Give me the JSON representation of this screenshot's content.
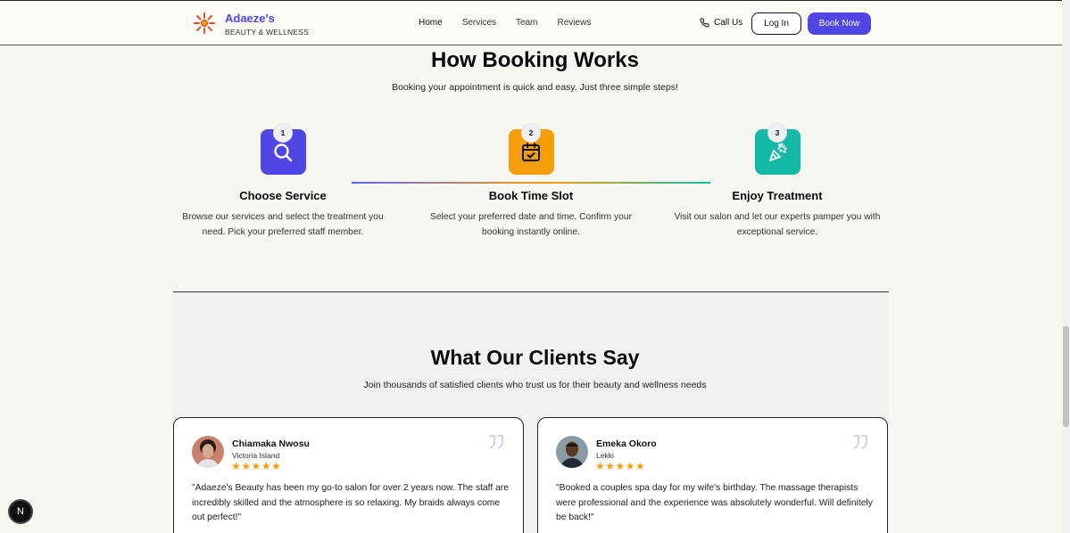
{
  "header": {
    "brand_name": "Adaeze's",
    "brand_tagline": "BEAUTY & WELLNESS",
    "nav": [
      {
        "label": "Home"
      },
      {
        "label": "Services"
      },
      {
        "label": "Team"
      },
      {
        "label": "Reviews"
      }
    ],
    "call_label": "Call Us",
    "login_label": "Log In",
    "book_label": "Book Now"
  },
  "booking": {
    "title": "How Booking Works",
    "subtitle": "Booking your appointment is quick and easy. Just three simple steps!",
    "steps": [
      {
        "number": "1",
        "icon": "search-icon",
        "color": "#4f46e5",
        "title": "Choose Service",
        "text": "Browse our services and select the treatment you need. Pick your preferred staff member."
      },
      {
        "number": "2",
        "icon": "calendar-check-icon",
        "color": "#f59e0b",
        "title": "Book Time Slot",
        "text": "Select your preferred date and time. Confirm your booking instantly online."
      },
      {
        "number": "3",
        "icon": "party-popper-icon",
        "color": "#14b8a6",
        "title": "Enjoy Treatment",
        "text": "Visit our salon and let our experts pamper you with exceptional service."
      }
    ]
  },
  "testimonials": {
    "title": "What Our Clients Say",
    "subtitle": "Join thousands of satisfied clients who trust us for their beauty and wellness needs",
    "items": [
      {
        "name": "Chiamaka Nwosu",
        "location": "Victoria Island",
        "rating": 5,
        "stars": "★★★★★",
        "text": "\"Adaeze's Beauty has been my go-to salon for over 2 years now. The staff are incredibly skilled and the atmosphere is so relaxing. My braids always come out perfect!\""
      },
      {
        "name": "Emeka Okoro",
        "location": "Lekki",
        "rating": 5,
        "stars": "★★★★★",
        "text": "\"Booked a couples spa day for my wife's birthday. The massage therapists were professional and the experience was absolutely wonderful. Will definitely be back!\""
      }
    ]
  },
  "dev_badge": "N",
  "colors": {
    "accent": "#4f46e5",
    "star": "#f59e0b",
    "teal": "#14b8a6"
  }
}
